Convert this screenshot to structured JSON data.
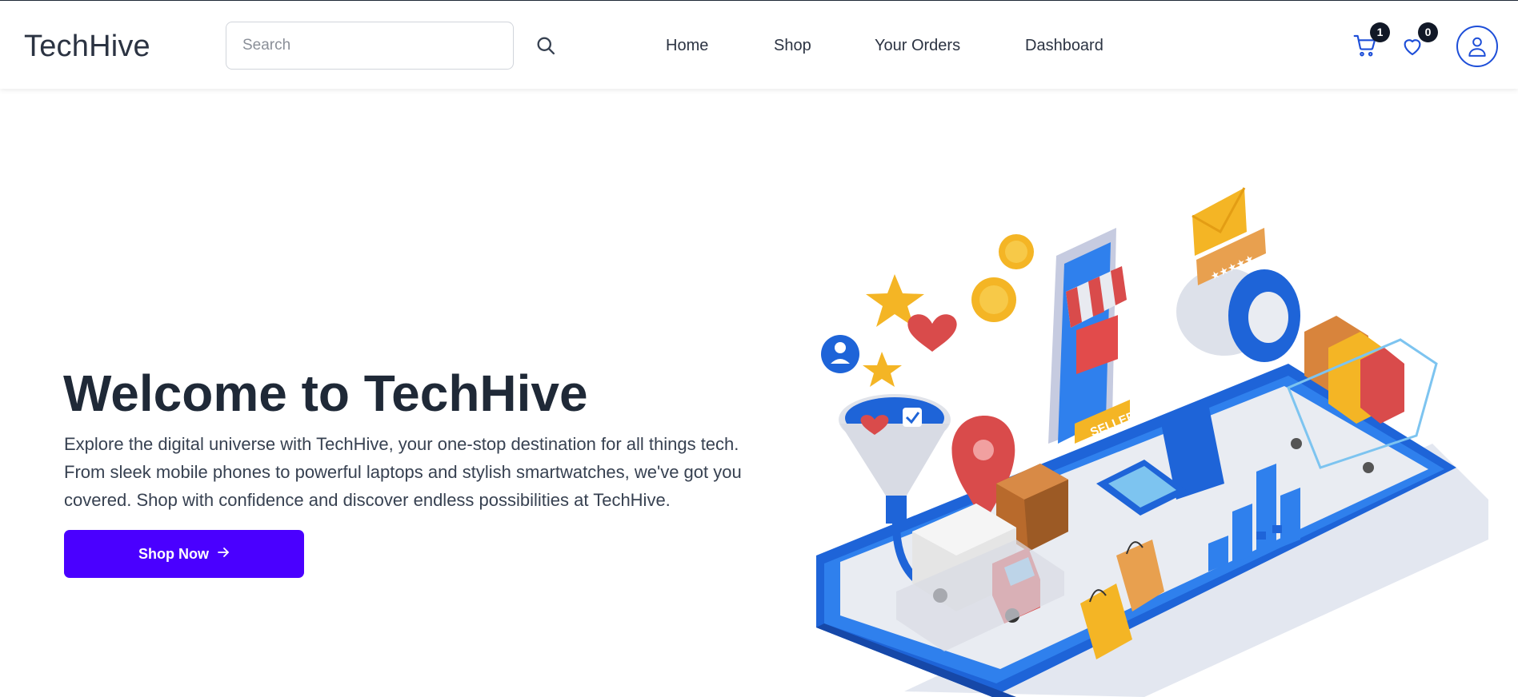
{
  "header": {
    "logo": "TechHive",
    "search": {
      "placeholder": "Search",
      "value": ""
    },
    "nav": [
      "Home",
      "Shop",
      "Your Orders",
      "Dashboard"
    ],
    "cart_count": "1",
    "wishlist_count": "0"
  },
  "hero": {
    "title": "Welcome to TechHive",
    "description": "Explore the digital universe with TechHive, your one-stop destination for all things tech. From sleek mobile phones to powerful laptops and stylish smartwatches, we've got you covered. Shop with confidence and discover endless possibilities at TechHive.",
    "cta_label": "Shop Now",
    "illustration_badge": "SELLER"
  },
  "colors": {
    "accent": "#4a00ff",
    "icon_blue": "#1d4ed8",
    "text_dark": "#1f2937"
  },
  "icons": [
    "search-icon",
    "cart-icon",
    "heart-icon",
    "user-icon",
    "arrow-right-icon"
  ]
}
